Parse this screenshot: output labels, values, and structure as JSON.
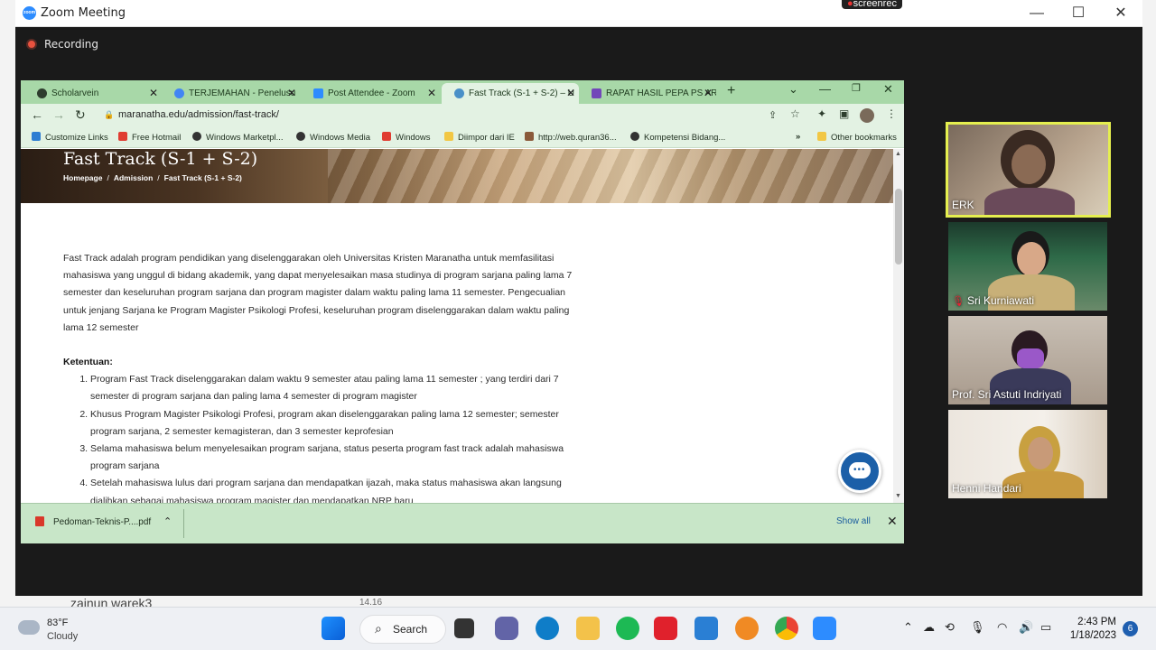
{
  "zoom": {
    "window_title": "Zoom Meeting",
    "logo_text": "zoom",
    "screenrec_label": "screenrec",
    "recording_label": "Recording"
  },
  "browser": {
    "tabs": [
      {
        "label": "Scholarvein",
        "icon": "globe-icon",
        "color": "#2d3d2d"
      },
      {
        "label": "TERJEMAHAN - Penelusu",
        "icon": "google-icon",
        "color": "#4285f4"
      },
      {
        "label": "Post Attendee - Zoom",
        "icon": "zoom-icon",
        "color": "#2d8cff"
      },
      {
        "label": "Fast Track (S-1 + S-2) – U",
        "icon": "globe-icon",
        "color": "#4a90c8"
      },
      {
        "label": "RAPAT HASIL PEPA PS AR",
        "icon": "forms-icon",
        "color": "#7248b9"
      }
    ],
    "url": "maranatha.edu/admission/fast-track/",
    "bookmarks": [
      {
        "label": "Customize Links",
        "color": "#2d7dd2"
      },
      {
        "label": "Free Hotmail",
        "color": "#e03c31"
      },
      {
        "label": "Windows Marketpl...",
        "color": "#333333"
      },
      {
        "label": "Windows Media",
        "color": "#333333"
      },
      {
        "label": "Windows",
        "color": "#e03c31"
      },
      {
        "label": "Diimpor dari IE",
        "color": "#f2c744"
      },
      {
        "label": "http://web.quran36...",
        "color": "#8a5a3a"
      },
      {
        "label": "Kompetensi Bidang...",
        "color": "#333333"
      }
    ],
    "other_bookmarks": "Other bookmarks",
    "more_glyph": "»",
    "download": {
      "filename": "Pedoman-Teknis-P....pdf",
      "show_all": "Show all"
    }
  },
  "page": {
    "hero_title": "Fast Track (S-1 + S-2)",
    "breadcrumbs": [
      "Homepage",
      "Admission",
      "Fast Track (S-1 + S-2)"
    ],
    "crumb_sep": "/",
    "intro": "Fast Track adalah program pendidikan yang diselenggarakan oleh Universitas Kristen Maranatha untuk memfasilitasi mahasiswa yang unggul di bidang akademik, yang dapat menyelesaikan masa studinya di program sarjana paling lama 7 semester dan keseluruhan program sarjana dan program magister dalam waktu paling lama 11 semester. Pengecualian untuk jenjang Sarjana ke Program Magister Psikologi Profesi, keseluruhan program diselenggarakan dalam waktu paling lama 12 semester",
    "ketentuan_title": "Ketentuan:",
    "ketentuan": [
      "Program Fast Track diselenggarakan dalam waktu 9 semester atau paling lama 11 semester ; yang terdiri dari 7 semester di program sarjana dan paling lama 4 semester di program magister",
      "Khusus Program Magister Psikologi Profesi, program akan diselenggarakan paling lama 12 semester; semester program sarjana, 2 semester kemagisteran, dan 3 semester keprofesian",
      "Selama mahasiswa belum menyelesaikan program sarjana, status peserta program fast track adalah mahasiswa program sarjana",
      "Setelah mahasiswa lulus dari program sarjana dan mendapatkan ijazah, maka status mahasiswa akan langsung dialihkan sebagai mahasiswa program magister dan mendapatkan NRP baru"
    ]
  },
  "participants": [
    {
      "name": "ERK",
      "active": true,
      "muted": false
    },
    {
      "name": "Sri Kurniawati",
      "active": false,
      "muted": true
    },
    {
      "name": "Prof. Sri Astuti Indriyati",
      "active": false,
      "muted": false
    },
    {
      "name": "Henni Handari",
      "active": false,
      "muted": false
    }
  ],
  "background": {
    "name": "zainun warek3",
    "number": "14.16"
  },
  "taskbar": {
    "temperature": "83°F",
    "condition": "Cloudy",
    "search_label": "Search",
    "time": "2:43 PM",
    "date": "1/18/2023",
    "notifications": "6"
  }
}
